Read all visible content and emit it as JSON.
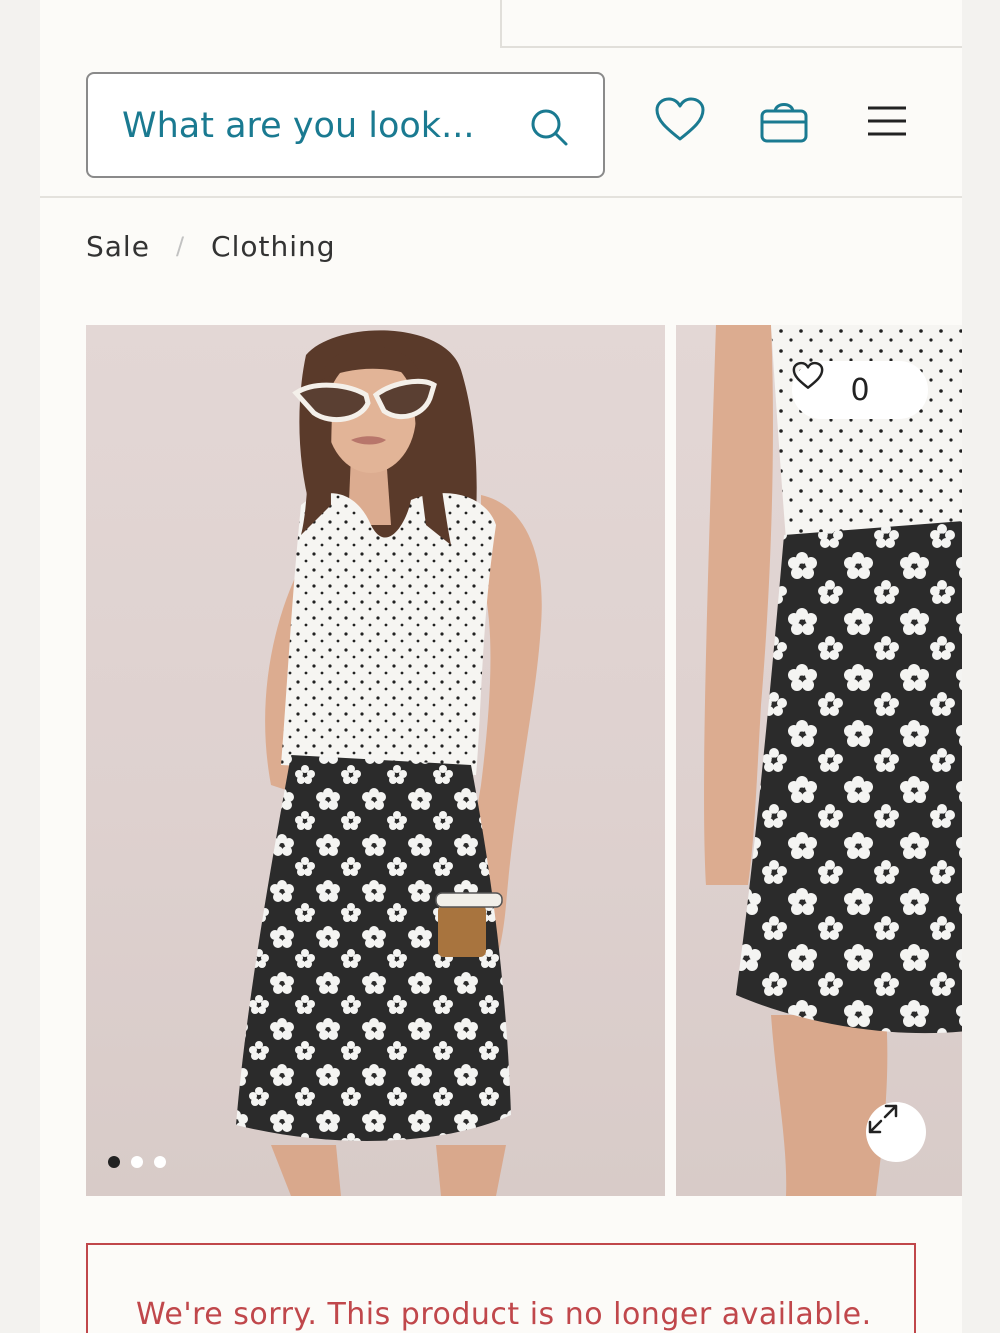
{
  "header": {
    "search": {
      "placeholder": "What are you look..."
    },
    "icons": [
      "search-icon",
      "heart-icon",
      "shopping-bag-icon",
      "hamburger-menu-icon"
    ]
  },
  "breadcrumb": {
    "items": [
      {
        "label": "Sale"
      },
      {
        "label": "Clothing"
      }
    ],
    "separator": "/"
  },
  "gallery": {
    "like_count": "0",
    "dots": [
      {
        "active": true
      },
      {
        "active": false
      },
      {
        "active": false
      }
    ],
    "icons": [
      "heart-icon",
      "expand-icon"
    ]
  },
  "notice": {
    "message": "We're sorry. This product is no longer available."
  },
  "colors": {
    "accent": "#1a7a91",
    "error": "#c0474b",
    "background": "#fcfbf8"
  }
}
